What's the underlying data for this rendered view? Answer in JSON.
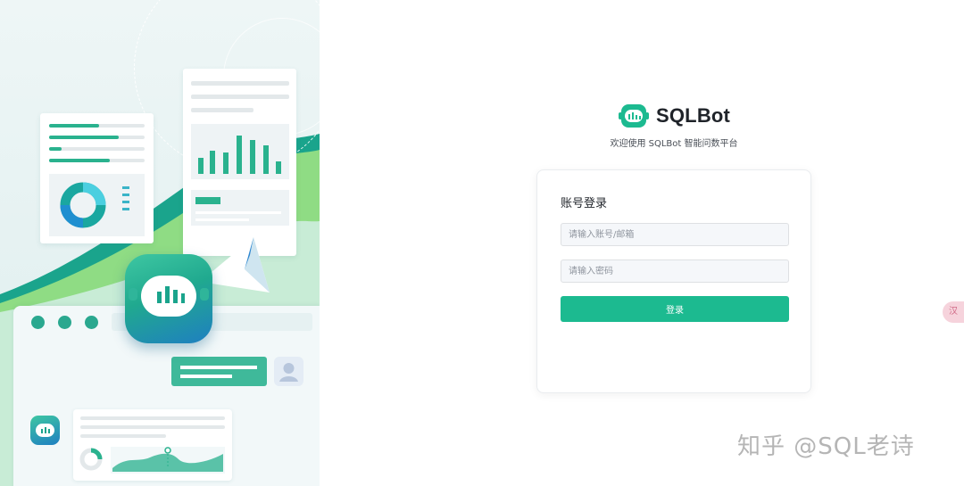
{
  "brand": {
    "name": "SQLBot",
    "tagline": "欢迎使用 SQLBot 智能问数平台",
    "logo_icon": "robot-chart-icon",
    "accent_color": "#1cba90"
  },
  "login": {
    "title": "账号登录",
    "username_placeholder": "请输入账号/邮箱",
    "username_value": "",
    "password_placeholder": "请输入密码",
    "password_value": "",
    "submit_label": "登录"
  },
  "side_widget": {
    "label": "汉"
  },
  "watermark": {
    "text": "知乎 @SQL老诗"
  }
}
